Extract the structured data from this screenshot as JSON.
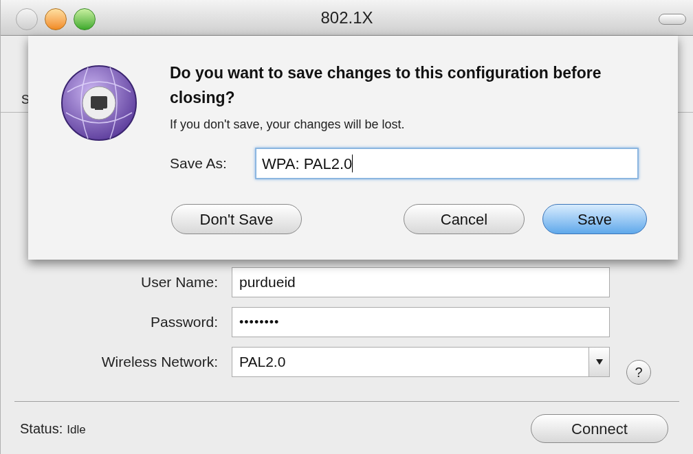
{
  "window": {
    "title": "802.1X"
  },
  "toolbar": {
    "label": "S"
  },
  "form": {
    "fields": [
      {
        "label": "User Name:",
        "value": "purdueid",
        "kind": "text"
      },
      {
        "label": "Password:",
        "value": "••••••••",
        "kind": "password"
      },
      {
        "label": "Wireless Network:",
        "value": "PAL2.0",
        "kind": "dropdown"
      }
    ]
  },
  "help_button": "?",
  "status": {
    "label": "Status:",
    "value": "Idle"
  },
  "connect_button": "Connect",
  "sheet": {
    "title": "Do you want to save changes to this configuration before closing?",
    "message": "If you don't save, your changes will be lost.",
    "save_as": {
      "label": "Save As:",
      "value": "WPA: PAL2.0"
    },
    "buttons": [
      {
        "label": "Don't Save",
        "default": false
      },
      {
        "label": "Cancel",
        "default": false
      },
      {
        "label": "Save",
        "default": true
      }
    ]
  }
}
